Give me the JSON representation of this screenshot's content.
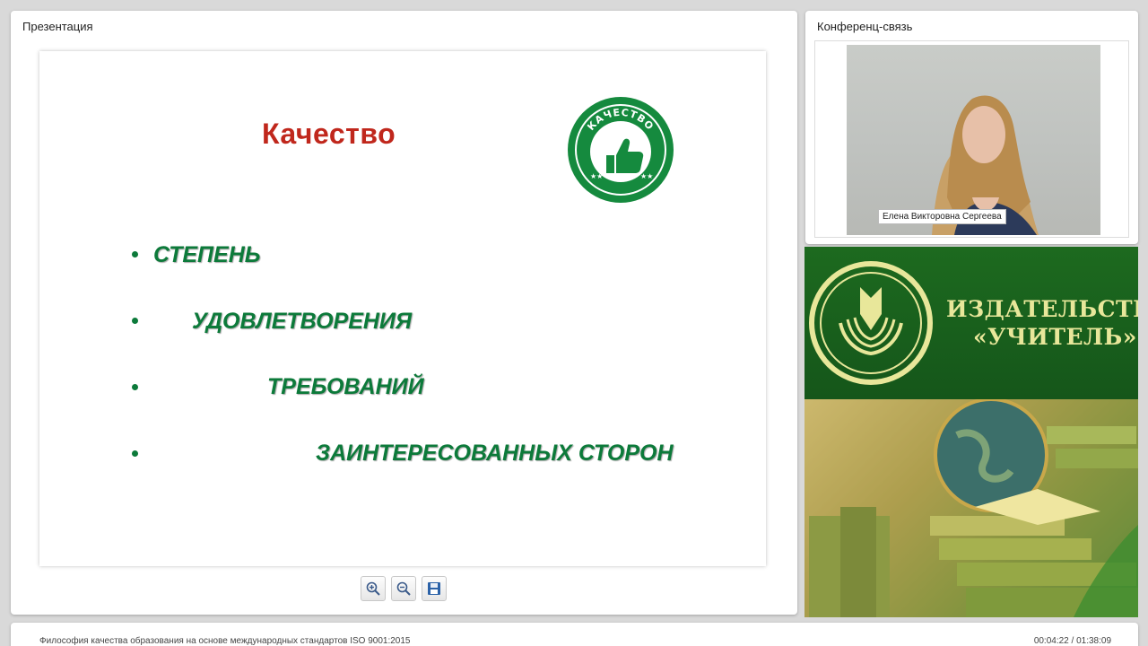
{
  "presentation": {
    "panel_title": "Презентация",
    "slide": {
      "title": "Качество",
      "badge_text": "КАЧЕСТВО",
      "bullets": [
        "СТЕПЕНЬ",
        "УДОВЛЕТВОРЕНИЯ",
        "ТРЕБОВАНИЙ",
        "ЗАИНТЕРЕСОВАННЫХ СТОРОН"
      ]
    },
    "toolbar": {
      "zoom_in_icon": "zoom-in-icon",
      "zoom_out_icon": "zoom-out-icon",
      "save_icon": "save-icon"
    }
  },
  "conference": {
    "panel_title": "Конференц-связь",
    "speaker_name": "Елена Викторовна Сергеева"
  },
  "publisher": {
    "line1": "ИЗДАТЕЛЬСТВО",
    "line2": "«УЧИТЕЛЬ»"
  },
  "footer": {
    "title": "Философия качества образования на основе  международных стандартов ISO 9001:2015",
    "time": "00:04:22 / 01:38:09"
  },
  "colors": {
    "title_red": "#c0271c",
    "bullet_green": "#0c7a3a",
    "banner_green": "#1d6a1f",
    "banner_text": "#e8e79a"
  }
}
